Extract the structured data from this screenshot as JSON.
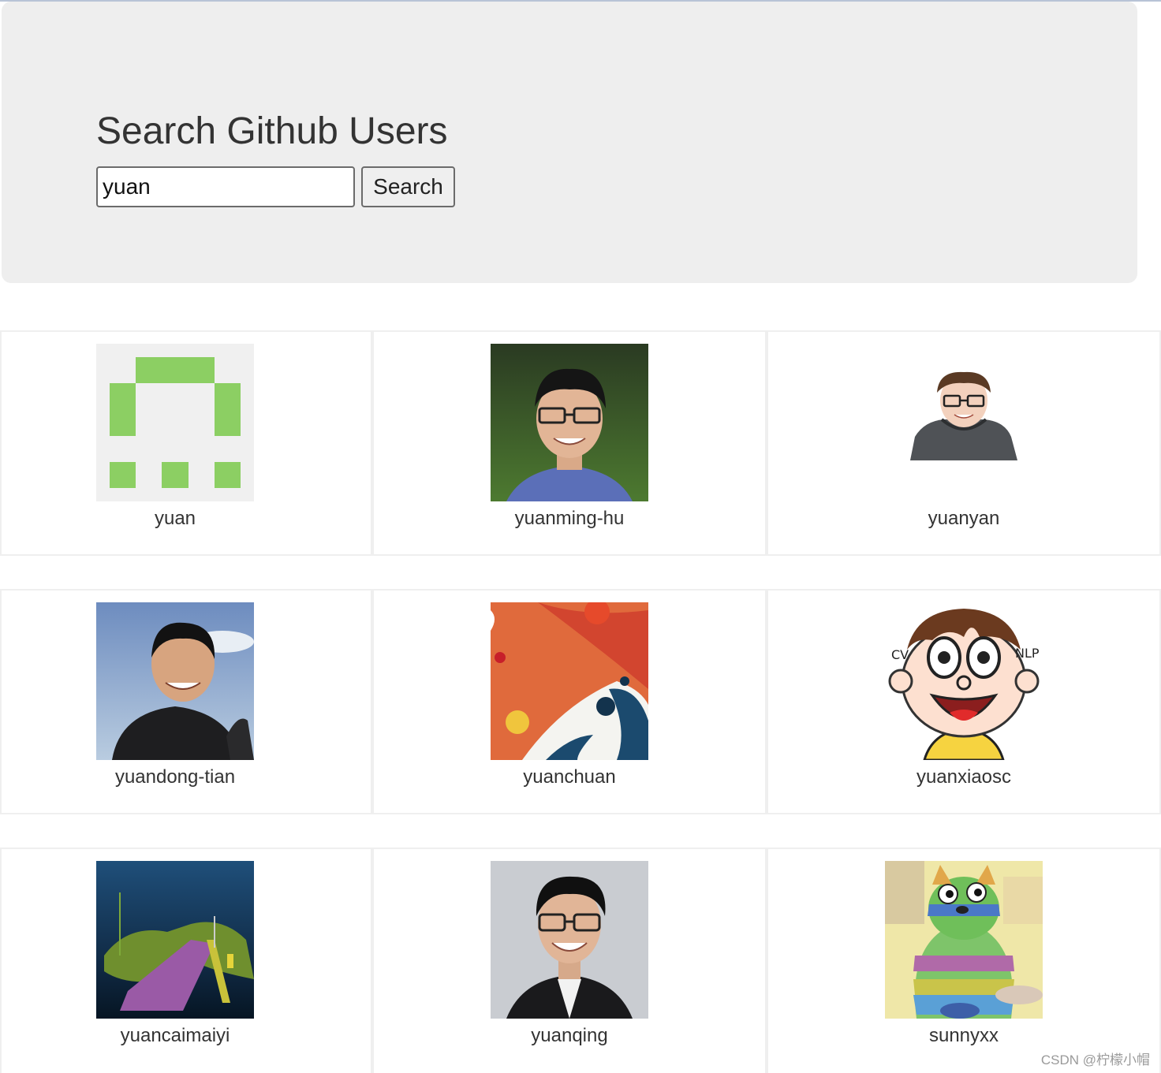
{
  "header": {
    "title": "Search Github Users",
    "search_value": "yuan",
    "search_button": "Search"
  },
  "users": [
    {
      "login": "yuan",
      "avatar": "identicon-green"
    },
    {
      "login": "yuanming-hu",
      "avatar": "photo-man-glasses-green-bg"
    },
    {
      "login": "yuanyan",
      "avatar": "cartoon-man-hoodie"
    },
    {
      "login": "yuandong-tian",
      "avatar": "photo-man-sky-bg"
    },
    {
      "login": "yuanchuan",
      "avatar": "abstract-orange-fish"
    },
    {
      "login": "yuanxiaosc",
      "avatar": "cartoon-boy-cv-nlp"
    },
    {
      "login": "yuancaimaiyi",
      "avatar": "point-cloud-road"
    },
    {
      "login": "yuanqing",
      "avatar": "photo-man-glasses-grey-bg"
    },
    {
      "login": "sunnyxx",
      "avatar": "rainbow-dog"
    }
  ],
  "avatar_texts": {
    "cv": "CV",
    "nlp": "NLP"
  },
  "watermark": "CSDN @柠檬小帽"
}
